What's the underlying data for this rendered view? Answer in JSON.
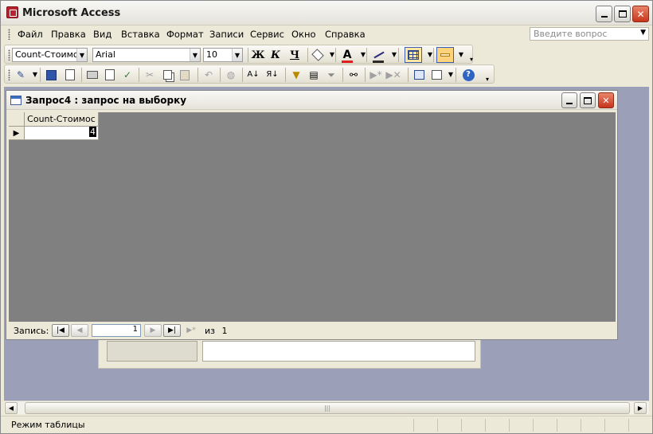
{
  "app": {
    "title": "Microsoft Access"
  },
  "window_controls": {
    "minimize": "_",
    "maximize": "□",
    "close": "✕"
  },
  "menu": {
    "items": [
      {
        "label": "Файл",
        "hotkey_pos": 0
      },
      {
        "label": "Правка"
      },
      {
        "label": "Вид"
      },
      {
        "label": "Вставка"
      },
      {
        "label": "Формат"
      },
      {
        "label": "Записи"
      },
      {
        "label": "Сервис"
      },
      {
        "label": "Окно"
      },
      {
        "label": "Справка"
      }
    ],
    "question_placeholder": "Введите вопрос"
  },
  "formatting_toolbar": {
    "object_combo": "Count-Стоимос",
    "font_combo": "Arial",
    "size_combo": "10",
    "bold": "Ж",
    "italic": "К",
    "underline": "Ч",
    "font_color_letter": "A"
  },
  "colors": {
    "mdi_background": "#9b9fb8",
    "datasheet_background": "#808080",
    "font_color_red": "#e02020",
    "title_text": "#1a1a1a"
  },
  "query_window": {
    "title": "Запрос4 : запрос на выборку",
    "column_header": "Count-Стоимос",
    "cell_value": "4"
  },
  "record_nav": {
    "label": "Запись:",
    "current": "1",
    "of_text": "из",
    "total": "1"
  },
  "status": {
    "text": "Режим таблицы"
  }
}
